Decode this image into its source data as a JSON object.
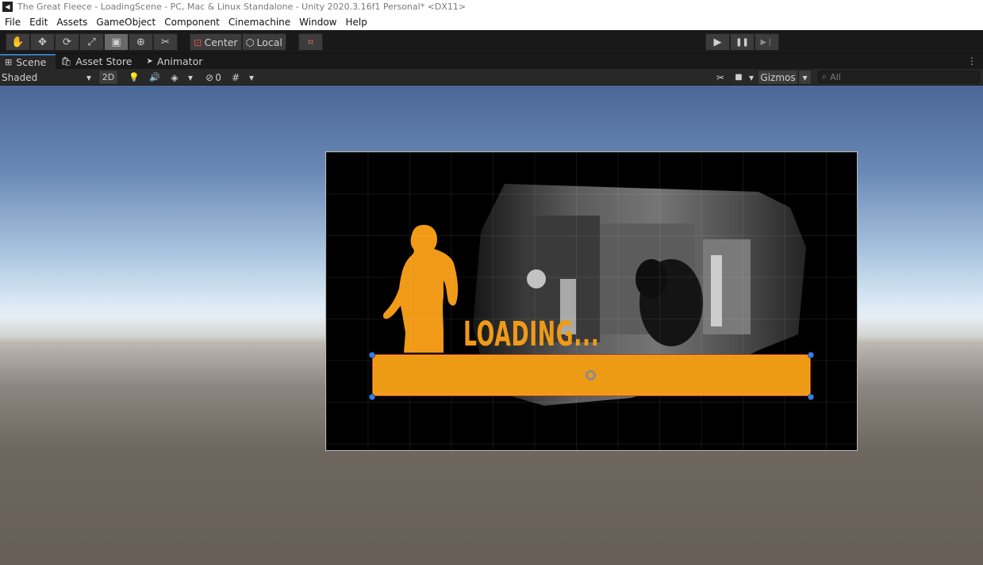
{
  "titlebar": {
    "title": "The Great Fleece - LoadingScene - PC, Mac & Linux Standalone - Unity 2020.3.16f1 Personal* <DX11>"
  },
  "menubar": {
    "items": [
      "File",
      "Edit",
      "Assets",
      "GameObject",
      "Component",
      "Cinemachine",
      "Window",
      "Help"
    ]
  },
  "toolbar": {
    "transform_tools": [
      {
        "name": "hand-tool",
        "glyph": "✋"
      },
      {
        "name": "move-tool",
        "glyph": "✥"
      },
      {
        "name": "rotate-tool",
        "glyph": "⟳"
      },
      {
        "name": "scale-tool",
        "glyph": "⤢"
      },
      {
        "name": "rect-tool",
        "glyph": "▣",
        "active": true
      },
      {
        "name": "transform-tool",
        "glyph": "⊕"
      },
      {
        "name": "custom-tool",
        "glyph": "✂"
      }
    ],
    "pivot_label": "Center",
    "handle_label": "Local",
    "snap_glyph": "⌗",
    "play_glyph": "▶",
    "pause_glyph": "❚❚",
    "step_glyph": "▶❘"
  },
  "tabs": [
    {
      "label": "Scene",
      "icon": "scene-icon",
      "glyph": "⊞",
      "active": true
    },
    {
      "label": "Asset Store",
      "icon": "asset-store-icon",
      "glyph": "🛍"
    },
    {
      "label": "Animator",
      "icon": "animator-icon",
      "glyph": "➤"
    }
  ],
  "tab_menu_glyph": "⋮",
  "scenebar": {
    "draw_mode": "Shaded",
    "dropdown_glyph": "▾",
    "mode_2d": "2D",
    "light_glyph": "💡",
    "audio_glyph": "🔊",
    "effects_glyph": "◈",
    "hidden_glyph": "⊘",
    "hidden_count": "0",
    "grid_glyph": "#",
    "tools_glyph": "✂",
    "camera_glyph": "■",
    "gizmos_label": "Gizmos",
    "search_placeholder": "All",
    "search_glyph": "⌕"
  },
  "game_ui": {
    "loading_text": "LOADING..."
  },
  "colors": {
    "accent_orange": "#ed9a14",
    "selection_border": "#c23a1a",
    "handle_blue": "#3d7ee0"
  }
}
